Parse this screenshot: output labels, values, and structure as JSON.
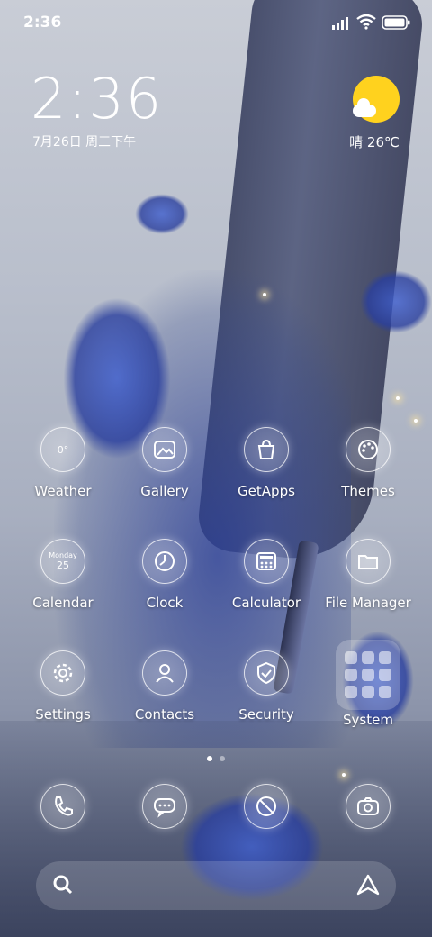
{
  "status_bar": {
    "time": "2:36"
  },
  "lock_widget": {
    "time": "2:36",
    "date": "7月26日 周三下午",
    "weather": "晴 26℃"
  },
  "home_apps": [
    {
      "label": "Weather",
      "icon": "weather-icon",
      "text": "0°"
    },
    {
      "label": "Gallery",
      "icon": "gallery-icon"
    },
    {
      "label": "GetApps",
      "icon": "getapps-bag-icon"
    },
    {
      "label": "Themes",
      "icon": "palette-icon"
    },
    {
      "label": "Calendar",
      "icon": "calendar-icon",
      "text": "Monday",
      "day": "25"
    },
    {
      "label": "Clock",
      "icon": "clock-icon"
    },
    {
      "label": "Calculator",
      "icon": "calculator-icon"
    },
    {
      "label": "File Manager",
      "icon": "folder-icon"
    },
    {
      "label": "Settings",
      "icon": "gear-icon"
    },
    {
      "label": "Contacts",
      "icon": "contact-icon"
    },
    {
      "label": "Security",
      "icon": "shield-check-icon"
    },
    {
      "label": "System",
      "icon": "system-folder-icon"
    }
  ],
  "dock": [
    {
      "icon": "phone-icon"
    },
    {
      "icon": "message-icon"
    },
    {
      "icon": "browser-icon"
    },
    {
      "icon": "camera-icon"
    }
  ],
  "page_indicator": {
    "pages": 2,
    "current": 1
  },
  "colors": {
    "accent_sun": "#ffd21e"
  }
}
